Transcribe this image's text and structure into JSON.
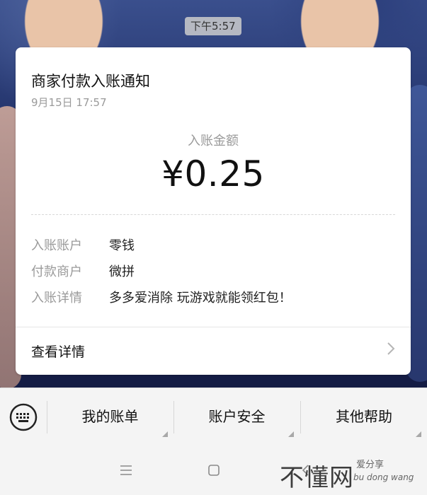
{
  "chat": {
    "timestamp": "下午5:57"
  },
  "card": {
    "title": "商家付款入账通知",
    "date": "9月15日  17:57",
    "amount_label": "入账金额",
    "amount": "¥0.25",
    "details": [
      {
        "key": "入账账户",
        "value": "零钱"
      },
      {
        "key": "付款商户",
        "value": "微拼"
      },
      {
        "key": "入账详情",
        "value": "多多爱消除 玩游戏就能领红包！"
      }
    ],
    "view_details": "查看详情",
    "chevron_icon": "chevron-right-icon"
  },
  "menu": {
    "keyboard_icon": "keyboard-icon",
    "items": [
      {
        "label": "我的账单"
      },
      {
        "label": "账户安全"
      },
      {
        "label": "其他帮助"
      }
    ]
  },
  "navbar": {
    "buttons": [
      "menu-icon",
      "home-icon",
      "back-icon"
    ]
  },
  "watermark": {
    "main": "不懂网",
    "sub1": "爱分享",
    "sub2": "bu dong wang"
  },
  "colors": {
    "card_bg": "#ffffff",
    "muted_text": "#9a9a9a",
    "menu_bg": "#f4f4f4"
  }
}
